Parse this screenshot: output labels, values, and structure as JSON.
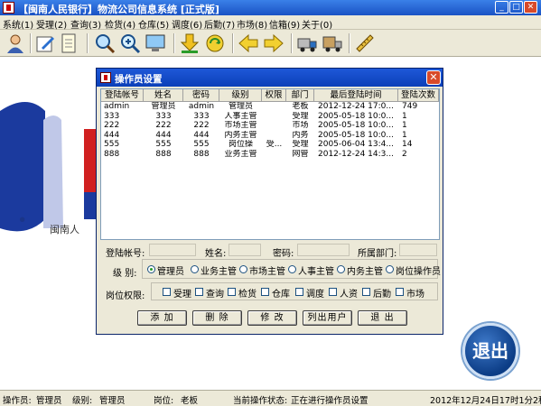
{
  "window": {
    "title": "【闽南人民银行】物流公司信息系统 [正式版]"
  },
  "menu": [
    "系统(1)",
    "受理(2)",
    "查询(3)",
    "检货(4)",
    "仓库(5)",
    "调度(6)",
    "后勤(7)",
    "市场(8)",
    "信箱(9)",
    "关于(0)"
  ],
  "toolbar_icons": [
    "user-icon",
    "edit-icon",
    "notepad-icon",
    "magnifier-icon",
    "zoom-icon",
    "monitor-icon",
    "download-icon",
    "refresh-icon",
    "arrow-left-icon",
    "arrow-right-icon",
    "truck-icon",
    "truck-load-icon",
    "ruler-icon"
  ],
  "background": {
    "logo_caption": "闽南人"
  },
  "dialog": {
    "title": "操作员设置",
    "close": "✕",
    "columns": [
      "登陆帐号",
      "姓名",
      "密码",
      "级别",
      "权限",
      "部门",
      "最后登陆时间",
      "登陆次数"
    ],
    "rows": [
      [
        "admin",
        "管理员",
        "admin",
        "管理员",
        "",
        "老板",
        "2012-12-24 17:0...",
        "749"
      ],
      [
        "333",
        "333",
        "333",
        "人事主管",
        "",
        "受理",
        "2005-05-18 10:0...",
        "1"
      ],
      [
        "222",
        "222",
        "222",
        "市场主管",
        "",
        "市场",
        "2005-05-18 10:0...",
        "1"
      ],
      [
        "444",
        "444",
        "444",
        "内务主管",
        "",
        "内务",
        "2005-05-18 10:0...",
        "1"
      ],
      [
        "555",
        "555",
        "555",
        "岗位操",
        "受...",
        "受理",
        "2005-06-04 13:4...",
        "14"
      ],
      [
        "888",
        "888",
        "888",
        "业务主管",
        "",
        "网管",
        "2012-12-24 14:3...",
        "2"
      ]
    ],
    "form": {
      "account_label": "登陆帐号:",
      "name_label": "姓名:",
      "password_label": "密码:",
      "dept_label": "所属部门:",
      "level_label": "级  别:",
      "levels": [
        "管理员",
        "业务主管",
        "市场主管",
        "人事主管",
        "内务主管",
        "岗位操作员"
      ],
      "perm_label": "岗位权限:",
      "perms": [
        "受理",
        "查询",
        "检货",
        "仓库",
        "调度",
        "人资",
        "后勤",
        "市场"
      ]
    },
    "buttons": [
      "添 加",
      "删 除",
      "修 改",
      "列出用户",
      "退 出"
    ]
  },
  "exit_button": "退出",
  "statusbar": {
    "operator_label": "操作员:",
    "operator": "管理员",
    "level_label": "级别:",
    "level": "管理员",
    "post_label": "岗位:",
    "post": "老板",
    "state_label": "当前操作状态:",
    "state": "正在进行操作员设置",
    "datetime": "2012年12月24日17时1分2秒"
  }
}
